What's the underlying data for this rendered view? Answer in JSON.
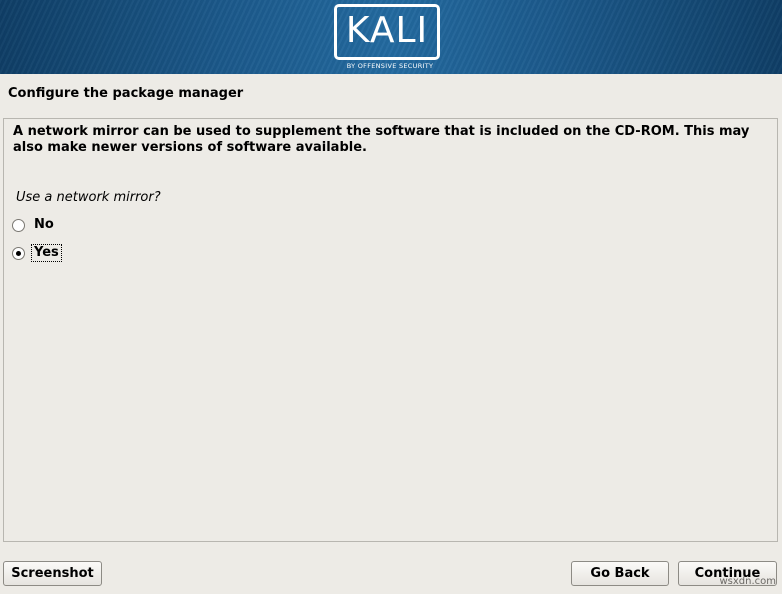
{
  "banner": {
    "logo_text": "KALI",
    "logo_subtitle": "BY OFFENSIVE SECURITY"
  },
  "page": {
    "title": "Configure the package manager"
  },
  "content": {
    "description": "A network mirror can be used to supplement the software that is included on the CD-ROM. This may also make newer versions of software available.",
    "question": "Use a network mirror?",
    "options": [
      {
        "label": "No",
        "selected": false
      },
      {
        "label": "Yes",
        "selected": true
      }
    ]
  },
  "buttons": {
    "screenshot": "Screenshot",
    "go_back": "Go Back",
    "continue": "Continue"
  },
  "watermark": "wsxdn.com",
  "colors": {
    "banner_dark": "#0f3e66",
    "banner_light": "#236aa0",
    "background": "#edebe6"
  }
}
